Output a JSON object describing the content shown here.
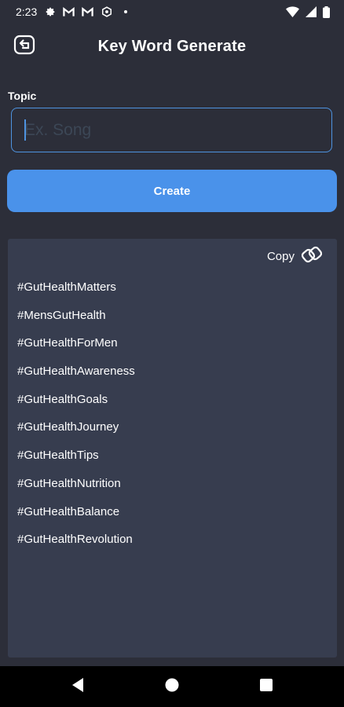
{
  "status_bar": {
    "time": "2:23",
    "left_icons": [
      "gear-icon",
      "gmail-icon",
      "gmail-icon",
      "settings-alt-icon",
      "dot-icon"
    ],
    "right_icons": [
      "wifi-icon",
      "signal-icon",
      "battery-icon"
    ]
  },
  "header": {
    "title": "Key Word Generate",
    "back_icon": "back-icon"
  },
  "form": {
    "topic_label": "Topic",
    "topic_placeholder": "Ex. Song",
    "topic_value": "",
    "create_label": "Create"
  },
  "results": {
    "copy_label": "Copy",
    "copy_icon": "copy-link-icon",
    "hashtags": [
      "#GutHealthMatters",
      "#MensGutHealth",
      "#GutHealthForMen",
      "#GutHealthAwareness",
      "#GutHealthGoals",
      "#GutHealthJourney",
      "#GutHealthTips",
      "#GutHealthNutrition",
      "#GutHealthBalance",
      "#GutHealthRevolution"
    ]
  },
  "nav_bar": {
    "buttons": [
      "back-triangle-icon",
      "home-circle-icon",
      "recents-square-icon"
    ]
  },
  "colors": {
    "background": "#2c2e39",
    "panel": "#373d4f",
    "accent": "#4a92ea",
    "input_border": "#4e93e0"
  }
}
